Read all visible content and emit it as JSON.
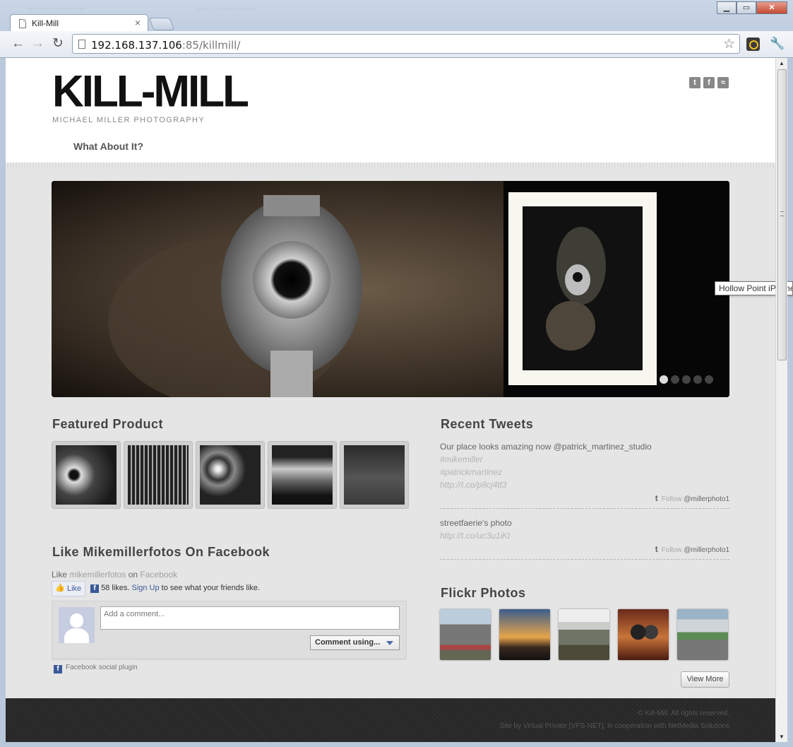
{
  "browser": {
    "tab_title": "Kill-Mill",
    "tab_close": "×",
    "url_host": "192.168.137.106",
    "url_rest": ":85/killmill/",
    "nav_back": "←",
    "nav_forward": "→",
    "nav_reload": "↻",
    "bookmark_star": "☆",
    "wrench": "🔧",
    "window_buttons": [
      "▁",
      "▭",
      "✕"
    ],
    "ghost_tabs": [
      "... ...... ... ...... ....",
      "...... .... ...... ........"
    ]
  },
  "site": {
    "logo": "KILL-MILL",
    "logo_sub": "MICHAEL MILLER PHOTOGRAPHY",
    "social_icons": [
      "twitter-icon",
      "facebook-icon",
      "rss-icon"
    ],
    "social_glyphs": [
      "t",
      "f",
      "≈"
    ],
    "nav": [
      "What About It?"
    ]
  },
  "slider": {
    "dots": 5,
    "active_dot": 0,
    "tooltip": "Hollow Point iPhone"
  },
  "featured": {
    "title": "Featured Product",
    "thumbs": [
      "revolver",
      "car-grille",
      "wire-wheels",
      "chrome-detail",
      "hollywood-sign"
    ]
  },
  "facebook": {
    "title": "Like Mikemillerfotos On Facebook",
    "like_prefix": "Like ",
    "like_page": "mikemillerfotos",
    "like_on": " on ",
    "like_site": "Facebook",
    "like_button": "Like",
    "likes_text": "58 likes.",
    "signup": "Sign Up",
    "likes_suffix": " to see what your friends like.",
    "comment_placeholder": "Add a comment...",
    "comment_using": "Comment using...",
    "plugin": "Facebook social plugin"
  },
  "tweets": {
    "title": "Recent Tweets",
    "items": [
      {
        "text": "Our place looks amazing now @patrick_martinez_studio",
        "tags": [
          "#mikemiller",
          "#patrickmartinez",
          "http://t.co/p8cj4tt3"
        ],
        "follow": "Follow",
        "handle": "@millerphoto1"
      },
      {
        "text": "streetfaerie's photo",
        "tags": [
          "http://t.co/uc3u1iKt"
        ],
        "follow": "Follow",
        "handle": "@millerphoto1"
      }
    ]
  },
  "flickr": {
    "title": "Flickr Photos",
    "photos": [
      "city-towers",
      "sunset-clouds",
      "mountain",
      "couple-dancing",
      "race-cars"
    ],
    "view_more": "View More"
  },
  "footer": {
    "copyright": "© Kill-Mill. All rights reserved.",
    "credit": "Site by Virtual Private [VPS-NET], in cooperation with NetMedia Solutions"
  }
}
